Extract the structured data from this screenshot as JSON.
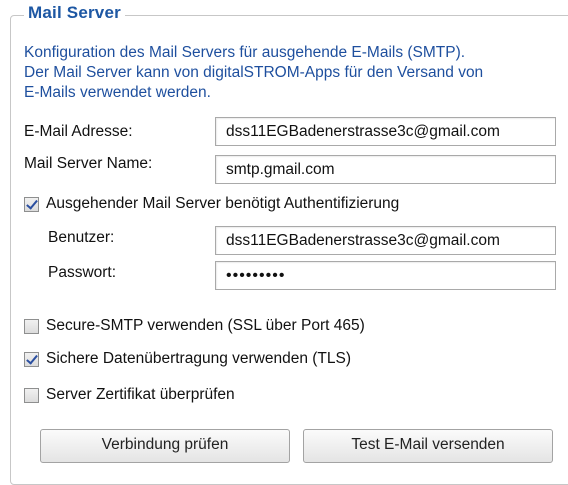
{
  "section": {
    "title": "Mail Server",
    "description": [
      "Konfiguration des Mail Servers für ausgehende E-Mails (SMTP).",
      "Der Mail Server kann von digitalSTROM-Apps für den Versand von",
      "E-Mails verwendet werden."
    ]
  },
  "fields": {
    "email": {
      "label": "E-Mail Adresse:",
      "value": "dss11EGBadenerstrasse3c@gmail.com"
    },
    "server_name": {
      "label": "Mail Server Name:",
      "value": "smtp.gmail.com"
    },
    "auth_required": {
      "label": "Ausgehender Mail Server benötigt Authentifizierung",
      "checked": true
    },
    "user": {
      "label": "Benutzer:",
      "value": "dss11EGBadenerstrasse3c@gmail.com"
    },
    "password": {
      "label": "Passwort:",
      "value": "•••••••••"
    },
    "secure_smtp": {
      "label": "Secure-SMTP verwenden (SSL über Port 465)",
      "checked": false
    },
    "tls": {
      "label": "Sichere Datenübertragung verwenden (TLS)",
      "checked": true
    },
    "verify_cert": {
      "label": "Server Zertifikat überprüfen",
      "checked": false
    }
  },
  "buttons": {
    "test_connection": "Verbindung prüfen",
    "send_test_mail": "Test E-Mail versenden"
  },
  "colors": {
    "accent": "#1d57a3",
    "description_text": "#1e4f9e",
    "border": "#c7c7c7"
  }
}
